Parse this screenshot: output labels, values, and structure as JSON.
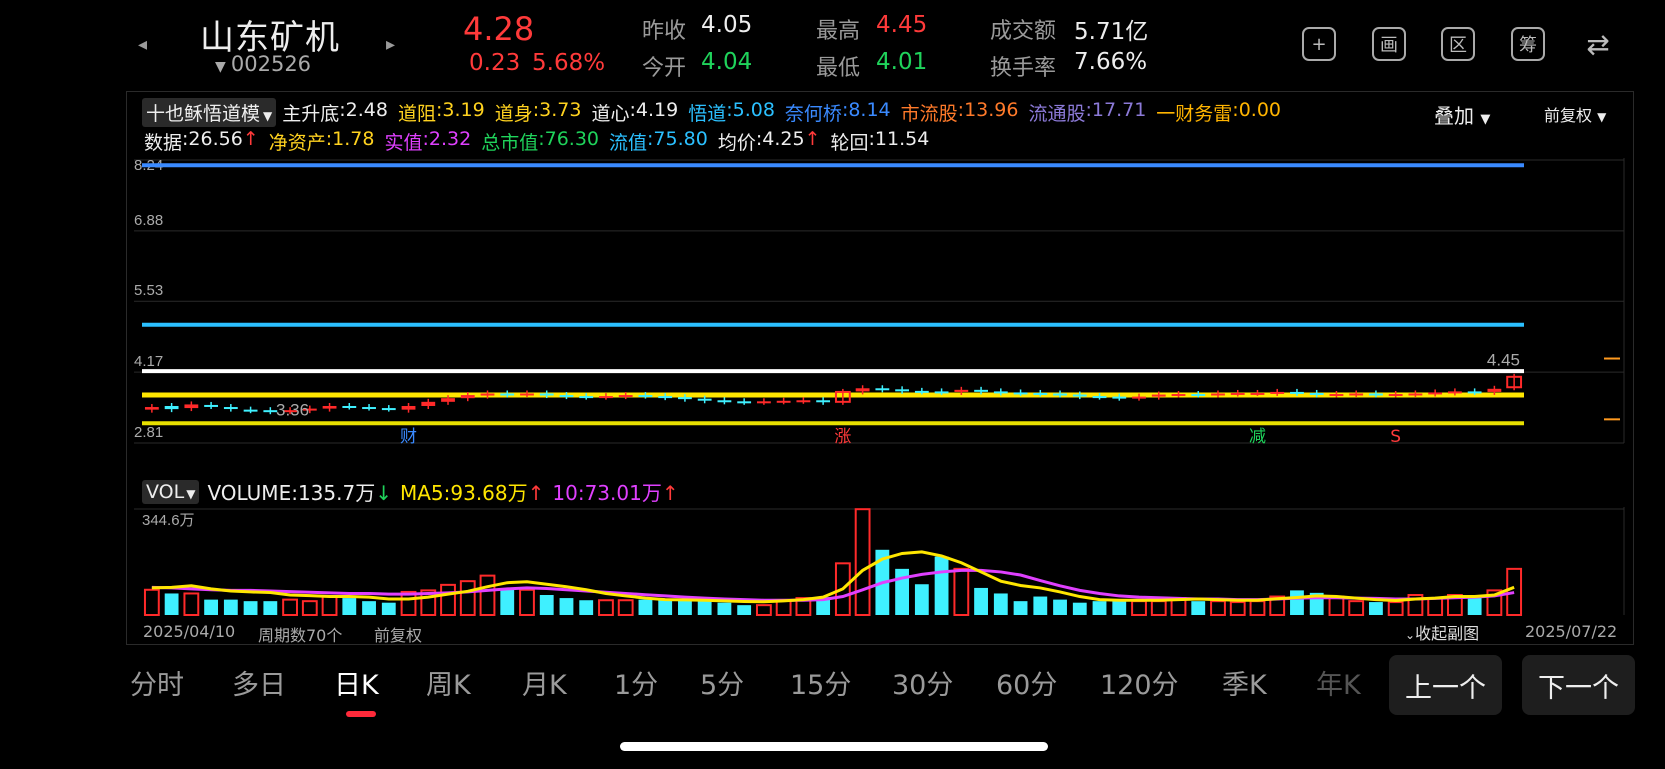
{
  "header": {
    "stock_name": "山东矿机",
    "stock_code": "002526",
    "price": "4.28",
    "change": "0.23",
    "change_pct": "5.68%",
    "stats": [
      {
        "label": "昨收",
        "value": "4.05",
        "color": "white"
      },
      {
        "label": "今开",
        "value": "4.04",
        "color": "green"
      },
      {
        "label": "最高",
        "value": "4.45",
        "color": "red"
      },
      {
        "label": "最低",
        "value": "4.01",
        "color": "green"
      },
      {
        "label": "成交额",
        "value": "5.71亿",
        "color": "white"
      },
      {
        "label": "换手率",
        "value": "7.66%",
        "color": "white"
      }
    ],
    "action_icons": [
      "plus-icon",
      "screen-icon",
      "range-icon",
      "chip-icon",
      "rotate-screen-icon"
    ],
    "action_glyphs": [
      "+",
      "画",
      "区",
      "筹",
      "⇄"
    ]
  },
  "indicators": {
    "selector_label": "十也稣悟道模",
    "overlay_label": "叠加",
    "adjust_label": "前复权",
    "row1": [
      {
        "label": "主升底",
        "value": "2.48",
        "color": "#eeeeee"
      },
      {
        "label": "道阻",
        "value": "3.19",
        "color": "#ffd21f"
      },
      {
        "label": "道身",
        "value": "3.73",
        "color": "#ffd21f"
      },
      {
        "label": "道心",
        "value": "4.19",
        "color": "#eeeeee"
      },
      {
        "label": "悟道",
        "value": "5.08",
        "color": "#2bc0ff"
      },
      {
        "label": "奈何桥",
        "value": "8.14",
        "color": "#3a8aff"
      },
      {
        "label": "市流股",
        "value": "13.96",
        "color": "#ff7a2a"
      },
      {
        "label": "流通股",
        "value": "17.71",
        "color": "#8c7ad8"
      },
      {
        "label": "一财务雷",
        "value": "0.00",
        "color": "#ffb400"
      }
    ],
    "row2": [
      {
        "label": "数据",
        "value": "26.56",
        "color": "#eeeeee",
        "arrow": "↑"
      },
      {
        "label": "净资产",
        "value": "1.78",
        "color": "#ffd21f",
        "arrow": ""
      },
      {
        "label": "实值",
        "value": "2.32",
        "color": "#e040ff",
        "arrow": ""
      },
      {
        "label": "总市值",
        "value": "76.30",
        "color": "#1fd35b",
        "arrow": ""
      },
      {
        "label": "流值",
        "value": "75.80",
        "color": "#2bc0ff",
        "arrow": ""
      },
      {
        "label": "均价",
        "value": "4.25",
        "color": "#eeeeee",
        "arrow": "↑"
      },
      {
        "label": "轮回",
        "value": "11.54",
        "color": "#eeeeee",
        "arrow": ""
      }
    ]
  },
  "price_chart": {
    "y_labels": [
      "8.24",
      "6.88",
      "5.53",
      "4.17",
      "2.81"
    ],
    "y_values": [
      8.24,
      6.88,
      5.53,
      4.17,
      2.81
    ],
    "low_marker": "3.36",
    "high_marker": "4.45",
    "lines": [
      {
        "name": "奈何桥",
        "value": 8.14,
        "color": "#3a8aff"
      },
      {
        "name": "悟道",
        "value": 5.08,
        "color": "#2bc0ff"
      },
      {
        "name": "道心",
        "value": 4.19,
        "color": "#ffffff"
      },
      {
        "name": "道身",
        "value": 3.73,
        "color": "#ffe600"
      },
      {
        "name": "道阻",
        "value": 3.19,
        "color": "#e8e000"
      }
    ],
    "markers": [
      {
        "text": "财",
        "index": 13,
        "color": "#3a8aff"
      },
      {
        "text": "涨",
        "index": 35,
        "color": "#ff3a3a"
      },
      {
        "text": "减",
        "index": 56,
        "color": "#1fd35b"
      },
      {
        "text": "S",
        "index": 63,
        "color": "#ff3a3a"
      }
    ]
  },
  "chart_data": {
    "type": "candlestick",
    "x_start": "2025/04/10",
    "x_end": "2025/07/22",
    "ohlc_close": [
      3.5,
      3.46,
      3.55,
      3.52,
      3.47,
      3.44,
      3.42,
      3.44,
      3.47,
      3.52,
      3.51,
      3.49,
      3.47,
      3.52,
      3.6,
      3.67,
      3.73,
      3.76,
      3.74,
      3.76,
      3.73,
      3.71,
      3.7,
      3.71,
      3.73,
      3.72,
      3.69,
      3.66,
      3.63,
      3.61,
      3.6,
      3.61,
      3.62,
      3.63,
      3.6,
      3.79,
      3.86,
      3.84,
      3.81,
      3.8,
      3.79,
      3.83,
      3.8,
      3.78,
      3.77,
      3.76,
      3.74,
      3.71,
      3.7,
      3.68,
      3.7,
      3.74,
      3.75,
      3.74,
      3.76,
      3.77,
      3.77,
      3.79,
      3.77,
      3.74,
      3.75,
      3.76,
      3.74,
      3.75,
      3.76,
      3.78,
      3.8,
      3.79,
      3.85,
      4.08
    ],
    "ohlc_open": [
      3.45,
      3.52,
      3.48,
      3.54,
      3.5,
      3.45,
      3.44,
      3.42,
      3.44,
      3.47,
      3.52,
      3.5,
      3.48,
      3.45,
      3.52,
      3.6,
      3.67,
      3.72,
      3.76,
      3.75,
      3.76,
      3.73,
      3.71,
      3.7,
      3.71,
      3.73,
      3.71,
      3.69,
      3.66,
      3.63,
      3.61,
      3.6,
      3.61,
      3.62,
      3.63,
      3.6,
      3.8,
      3.86,
      3.84,
      3.81,
      3.8,
      3.79,
      3.83,
      3.8,
      3.78,
      3.77,
      3.76,
      3.74,
      3.71,
      3.7,
      3.68,
      3.7,
      3.74,
      3.75,
      3.74,
      3.76,
      3.77,
      3.77,
      3.79,
      3.77,
      3.74,
      3.75,
      3.76,
      3.74,
      3.75,
      3.76,
      3.78,
      3.8,
      3.79,
      3.88
    ],
    "volume": [
      82,
      70,
      70,
      50,
      50,
      45,
      45,
      50,
      45,
      60,
      55,
      45,
      40,
      75,
      80,
      98,
      110,
      128,
      86,
      82,
      65,
      55,
      48,
      48,
      48,
      50,
      52,
      47,
      45,
      40,
      32,
      32,
      48,
      55,
      58,
      168,
      344,
      212,
      150,
      100,
      190,
      150,
      88,
      70,
      45,
      60,
      50,
      40,
      45,
      45,
      45,
      45,
      55,
      45,
      45,
      42,
      45,
      60,
      80,
      72,
      60,
      45,
      42,
      42,
      65,
      55,
      65,
      60,
      80,
      150
    ],
    "ma5": [
      88,
      90,
      95,
      85,
      78,
      75,
      73,
      65,
      63,
      60,
      60,
      58,
      52,
      52,
      58,
      68,
      77,
      92,
      105,
      108,
      100,
      92,
      82,
      70,
      62,
      55,
      50,
      49,
      48,
      46,
      44,
      43,
      46,
      50,
      58,
      85,
      145,
      182,
      200,
      205,
      192,
      170,
      140,
      110,
      96,
      88,
      75,
      60,
      50,
      48,
      48,
      48,
      50,
      52,
      50,
      48,
      48,
      53,
      57,
      62,
      60,
      55,
      50,
      47,
      52,
      55,
      60,
      60,
      65,
      90
    ],
    "ma10": [
      90,
      88,
      85,
      82,
      80,
      80,
      78,
      76,
      74,
      72,
      70,
      70,
      68,
      68,
      70,
      72,
      75,
      80,
      85,
      88,
      86,
      82,
      78,
      74,
      70,
      66,
      62,
      58,
      55,
      52,
      50,
      48,
      48,
      48,
      50,
      60,
      82,
      105,
      120,
      132,
      140,
      145,
      145,
      140,
      130,
      112,
      95,
      80,
      70,
      62,
      58,
      56,
      54,
      52,
      52,
      50,
      50,
      52,
      55,
      56,
      56,
      55,
      54,
      52,
      52,
      54,
      56,
      58,
      62,
      73
    ]
  },
  "volume": {
    "selector_label": "VOL",
    "volume_label": "VOLUME:135.7万",
    "volume_arrow": "↓",
    "ma5_label": "MA5:93.68万",
    "ma5_arrow": "↑",
    "ma10_label": "10:73.01万",
    "ma10_arrow": "↑",
    "max_label": "344.6万"
  },
  "footer": {
    "start_date": "2025/04/10",
    "period_count": "周期数70个",
    "adjust": "前复权",
    "collapse_label": "收起副图",
    "end_date": "2025/07/22"
  },
  "timeframes": [
    "分时",
    "多日",
    "日K",
    "周K",
    "月K",
    "1分",
    "5分",
    "15分",
    "30分",
    "60分",
    "120分",
    "季K",
    "年K"
  ],
  "active_timeframe": "日K",
  "nav_buttons": {
    "prev": "上一个",
    "next": "下一个"
  }
}
